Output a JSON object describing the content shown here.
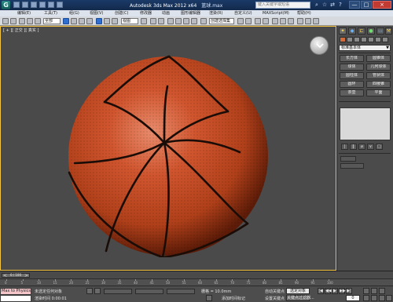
{
  "titlebar": {
    "app_logo_letter": "G",
    "title": "Autodesk 3ds Max  2012 x64",
    "filename": "篮球.max",
    "search_placeholder": "键入关键字或短语",
    "icons": [
      "binoculars-icon",
      "star-icon",
      "exchange-icon",
      "help-icon"
    ],
    "minimize": "—",
    "maximize": "□",
    "close": "×"
  },
  "menubar": {
    "items": [
      "编辑(E)",
      "工具(T)",
      "组(G)",
      "视图(V)",
      "创建(C)",
      "修改器",
      "动画",
      "图形编辑器",
      "渲染(R)",
      "自定义(U)",
      "MAXScript(M)",
      "帮助(H)"
    ]
  },
  "toolbar": {
    "selection_filter": "全部",
    "ref_coord": "视图",
    "named_selection": "创建选择集"
  },
  "viewport": {
    "label": "[ + ][ 正交 ][ 真实 ]"
  },
  "command_panel": {
    "tabs": [
      "create-tab",
      "modify-tab",
      "hierarchy-tab",
      "motion-tab",
      "display-tab",
      "utilities-tab"
    ],
    "dropdown": "标准基本体",
    "section_title": "对象类型",
    "buttons": [
      "长方体",
      "圆锥体",
      "球体",
      "几何球体",
      "圆柱体",
      "管状体",
      "圆环",
      "四棱锥",
      "茶壶",
      "平面"
    ],
    "mini_buttons": [
      "|",
      "‖",
      "⌀",
      "∨",
      "□"
    ]
  },
  "timeslider": {
    "frame": "0 / 100",
    "prev": "<",
    "next": ">"
  },
  "trackbar": {
    "ticks": [
      "0",
      "5",
      "10",
      "15",
      "20",
      "25",
      "30",
      "35",
      "40",
      "45",
      "50",
      "55",
      "60",
      "65",
      "70",
      "75",
      "80",
      "85",
      "90",
      "95",
      "100"
    ]
  },
  "statusbar": {
    "maxscript": "Max to Physics",
    "status_top": "未选定任何对象",
    "status_bottom": "渲染时间 0:00:01",
    "grid": "栅格 = 10.0mm",
    "add_time_tag": "添加时间标记",
    "auto_key": "自动关键点",
    "selected_object": "选定对象",
    "set_key": "设置关键点",
    "key_filters": "关键点过滤器...",
    "frame_value": "0",
    "playback": [
      "|◀",
      "◀◀",
      "▶",
      "▶▶",
      "▶|"
    ]
  },
  "colors": {
    "accent_blue": "#2f6fcf",
    "ball_orange": "#c2461d",
    "viewport_border": "#f4c542"
  }
}
